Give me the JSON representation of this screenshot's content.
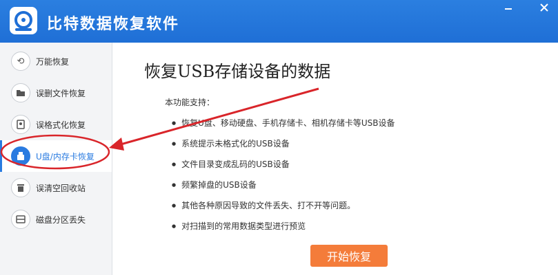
{
  "app": {
    "title": "比特数据恢复软件",
    "accent_color": "#2a7be0",
    "titlebar_color": "#1f6fd6"
  },
  "window_controls": {
    "minimize_icon": "minimize-icon",
    "close_icon": "close-icon"
  },
  "sidebar": {
    "items": [
      {
        "label": "万能恢复",
        "icon": "refresh-icon"
      },
      {
        "label": "误删文件恢复",
        "icon": "folder-icon"
      },
      {
        "label": "误格式化恢复",
        "icon": "disk-icon"
      },
      {
        "label": "U盘/内存卡恢复",
        "icon": "usb-icon",
        "active": true
      },
      {
        "label": "误清空回收站",
        "icon": "trash-icon"
      },
      {
        "label": "磁盘分区丢失",
        "icon": "partition-icon"
      }
    ]
  },
  "main": {
    "title": "恢复USB存储设备的数据",
    "support_label": "本功能支持：",
    "features": [
      "恢复U盘、移动硬盘、手机存储卡、相机存储卡等USB设备",
      "系统提示未格式化的USB设备",
      "文件目录变成乱码的USB设备",
      "频繁掉盘的USB设备",
      "其他各种原因导致的文件丢失、打不开等问题。",
      "对扫描到的常用数据类型进行预览"
    ],
    "start_button": "开始恢复",
    "start_button_color": "#f47c3a"
  },
  "annotation": {
    "color": "#d9252a"
  }
}
